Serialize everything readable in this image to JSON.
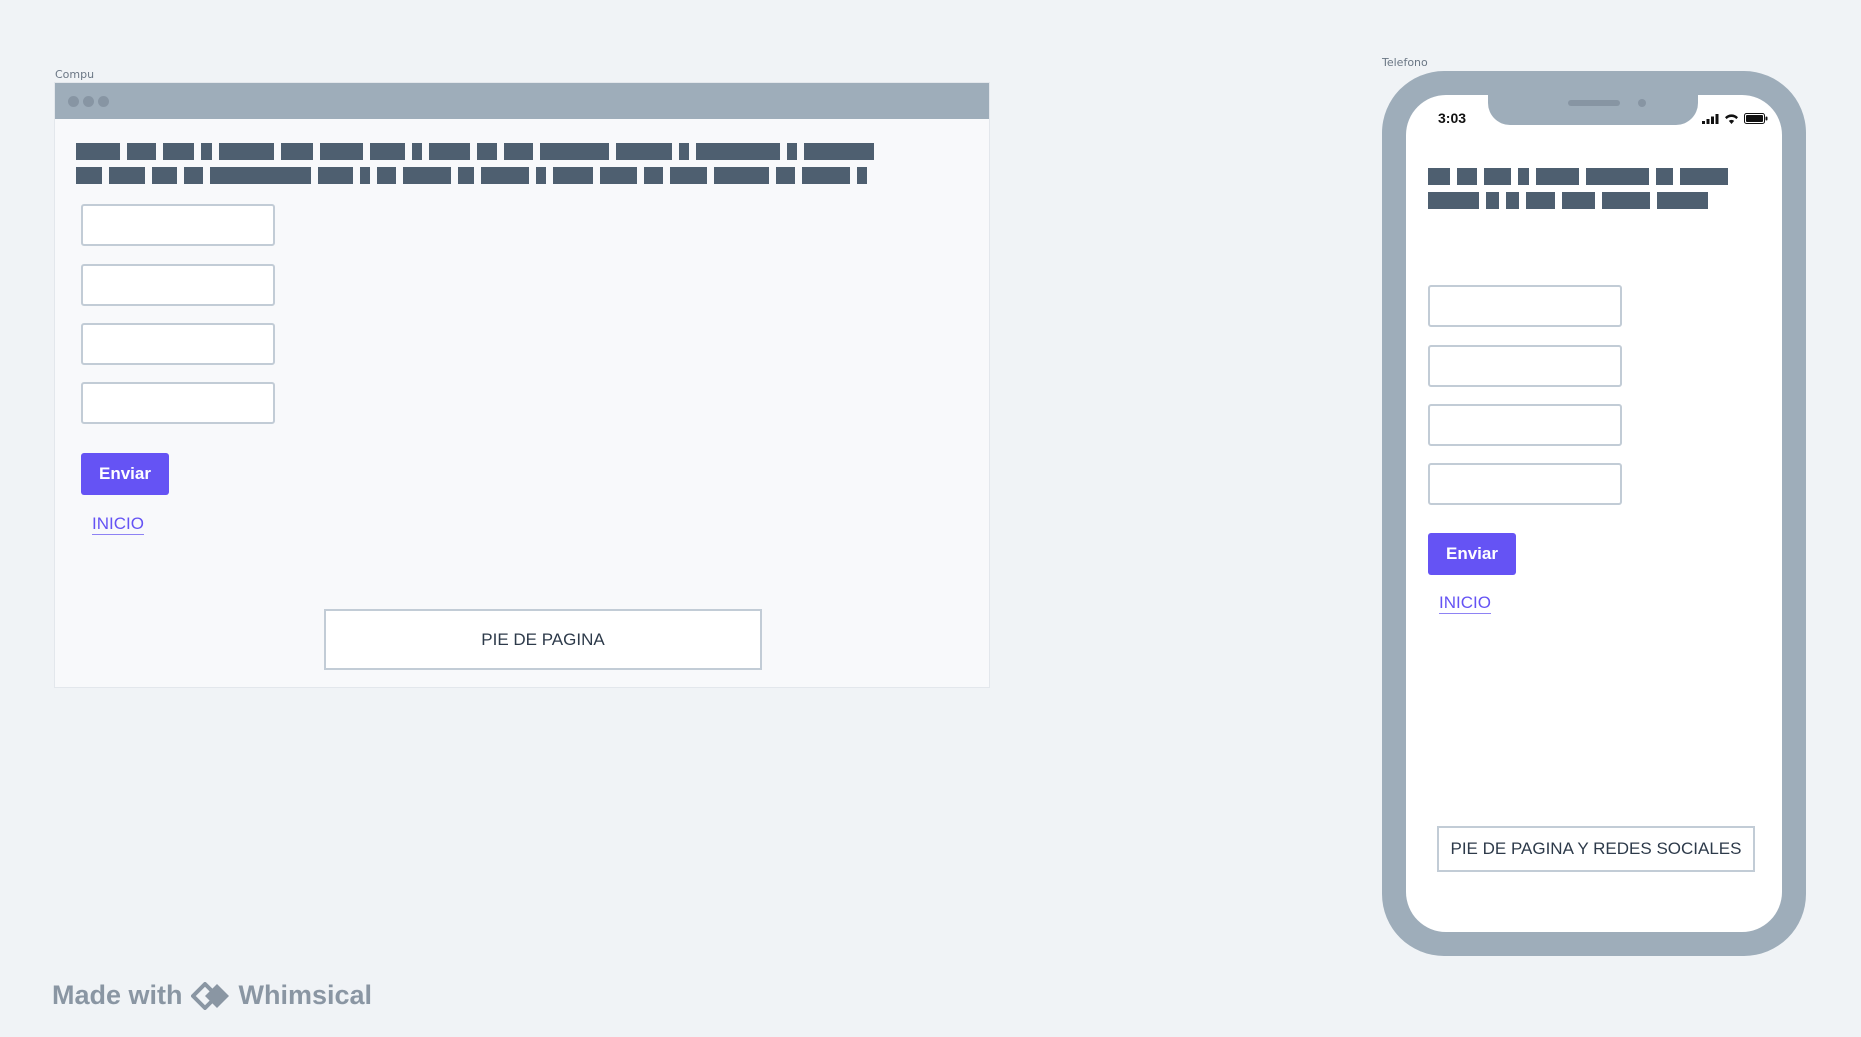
{
  "desktop": {
    "frame_label": "Compu",
    "submit_label": "Enviar",
    "home_link": "INICIO",
    "footer": "PIE DE PAGINA",
    "redacted_text_row1": [
      30,
      20,
      22,
      7,
      38,
      22,
      30,
      24,
      7,
      28,
      14,
      20,
      48,
      38,
      7,
      58,
      7,
      48
    ],
    "redacted_text_row2": [
      18,
      25,
      17,
      13,
      70,
      24,
      7,
      13,
      33,
      11,
      33,
      7,
      28,
      25,
      13,
      26,
      38,
      13,
      33,
      7
    ]
  },
  "phone": {
    "frame_label": "Telefono",
    "time": "3:03",
    "submit_label": "Enviar",
    "home_link": "INICIO",
    "footer": "PIE DE PAGINA Y REDES SOCIALES",
    "redacted_text_row1": [
      14,
      12,
      17,
      7,
      27,
      39,
      11,
      30
    ],
    "redacted_text_row2": [
      32,
      8,
      8,
      18,
      21,
      30,
      32
    ]
  },
  "branding": {
    "made_with": "Made with",
    "brand": "Whimsical"
  },
  "colors": {
    "accent": "#6553f4",
    "frame": "#9eadba",
    "redaction": "#4e5f70",
    "background": "#f0f3f6"
  }
}
